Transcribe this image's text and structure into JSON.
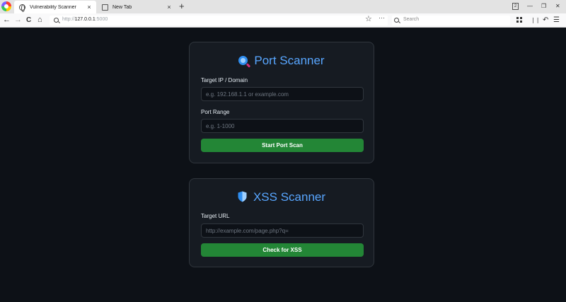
{
  "browser": {
    "tabs": [
      {
        "title": "Vulnerability Scanner",
        "active": true,
        "icon": "globe-icon"
      },
      {
        "title": "New Tab",
        "active": false,
        "icon": "newtab-icon"
      }
    ],
    "url_scheme": "http://",
    "url_host": "127.0.0.1",
    "url_port": ":5000",
    "search_placeholder": "Search",
    "window_badge": "2",
    "icons": {
      "back": "←",
      "forward": "→",
      "reload": "C",
      "home": "⌂",
      "bookmark": "☆",
      "more": "···",
      "tab_close": "×",
      "new_tab": "+",
      "minimize": "—",
      "restore": "❐",
      "close": "✕",
      "library": "❘❘",
      "undo": "↶",
      "menu": "☰"
    }
  },
  "port_scanner": {
    "title": "Port Scanner",
    "target_label": "Target IP / Domain",
    "target_placeholder": "e.g. 192.168.1.1 or example.com",
    "range_label": "Port Range",
    "range_placeholder": "e.g. 1-1000",
    "button": "Start Port Scan",
    "icon": "magnifying-glass-icon"
  },
  "xss_scanner": {
    "title": "XSS Scanner",
    "url_label": "Target URL",
    "url_placeholder": "http://example.com/page.php?q=",
    "button": "Check for XSS",
    "icon": "shield-icon"
  },
  "colors": {
    "background": "#0d1117",
    "card": "#161b22",
    "accent": "#58a6ff",
    "button": "#238636"
  }
}
